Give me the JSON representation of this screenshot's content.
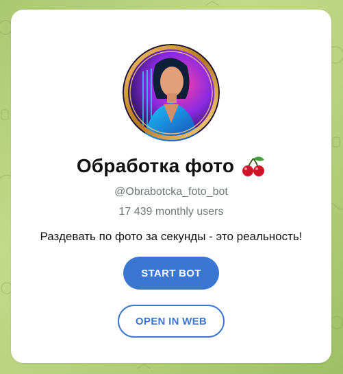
{
  "bot": {
    "title": "Обработка фото",
    "title_emoji": "cherry-emoji",
    "username": "@Obrabotcka_foto_bot",
    "monthly_users": "17 439 monthly users",
    "description": "Раздевать по фото за секунды - это реальность!"
  },
  "buttons": {
    "start_label": "START BOT",
    "web_label": "OPEN IN WEB"
  },
  "colors": {
    "accent": "#3a76d2",
    "background": "#b5d07a",
    "card": "#ffffff",
    "muted_text": "#707579"
  },
  "avatar": {
    "icon": "bot-avatar-portrait"
  }
}
